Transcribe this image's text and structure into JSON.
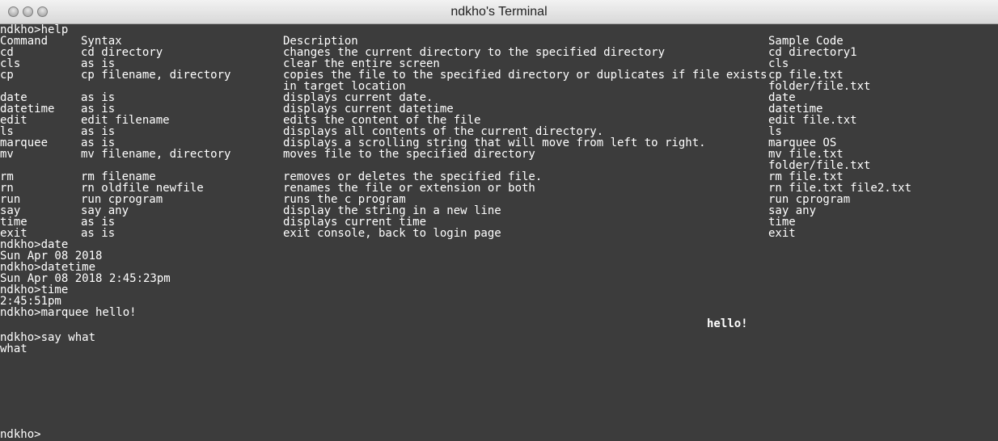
{
  "window": {
    "title": "ndkho's Terminal"
  },
  "help": {
    "prompt": "ndkho>help",
    "header": {
      "command": "Command",
      "syntax": "Syntax",
      "description": "Description",
      "sample": "Sample Code"
    },
    "rows": [
      {
        "cmd": "cd",
        "syn": "cd directory",
        "desc": "changes the current directory to the specified directory",
        "sample": "cd directory1"
      },
      {
        "cmd": "cls",
        "syn": "as is",
        "desc": "clear the entire screen",
        "sample": "cls"
      },
      {
        "cmd": "cp",
        "syn": "cp filename, directory",
        "desc": "copies the file to the specified directory or duplicates if file exists",
        "sample": "cp file.txt"
      },
      {
        "cmd": "",
        "syn": "",
        "desc": "in target location",
        "sample": "folder/file.txt"
      },
      {
        "cmd": "date",
        "syn": "as is",
        "desc": "displays current date.",
        "sample": "date"
      },
      {
        "cmd": "datetime",
        "syn": "as is",
        "desc": "displays current datetime",
        "sample": "datetime"
      },
      {
        "cmd": "edit",
        "syn": "edit filename",
        "desc": "edits the content of the file",
        "sample": "edit file.txt"
      },
      {
        "cmd": "ls",
        "syn": "as is",
        "desc": "displays all contents of the current directory.",
        "sample": "ls"
      },
      {
        "cmd": "marquee",
        "syn": "as is",
        "desc": "displays a scrolling string that will move from left to right.",
        "sample": "marquee OS"
      },
      {
        "cmd": "mv",
        "syn": "mv filename, directory",
        "desc": "moves file to the specified directory",
        "sample": "mv file.txt"
      },
      {
        "cmd": "",
        "syn": "",
        "desc": "",
        "sample": "folder/file.txt"
      },
      {
        "cmd": "rm",
        "syn": "rm filename",
        "desc": "removes or deletes the specified file.",
        "sample": "rm file.txt"
      },
      {
        "cmd": "rn",
        "syn": "rn oldfile newfile",
        "desc": "renames the file or extension or both",
        "sample": "rn file.txt file2.txt"
      },
      {
        "cmd": "run",
        "syn": "run cprogram",
        "desc": "runs the c program",
        "sample": "run cprogram"
      },
      {
        "cmd": "say",
        "syn": "say any",
        "desc": "display the string in a new line",
        "sample": "say any"
      },
      {
        "cmd": "time",
        "syn": "as is",
        "desc": "displays current time",
        "sample": "time"
      },
      {
        "cmd": "exit",
        "syn": "as is",
        "desc": "exit console, back to login page",
        "sample": "exit"
      }
    ]
  },
  "session": {
    "date_prompt": "ndkho>date",
    "date_out": "Sun Apr 08 2018",
    "datetime_prompt": "ndkho>datetime",
    "datetime_out": "Sun Apr 08 2018 2:45:23pm",
    "time_prompt": "ndkho>time",
    "time_out": "2:45:51pm",
    "marquee_prompt": "ndkho>marquee hello!",
    "marquee_out": "hello!",
    "say_prompt": "ndkho>say what",
    "say_out": "what",
    "final_prompt": "ndkho>"
  }
}
